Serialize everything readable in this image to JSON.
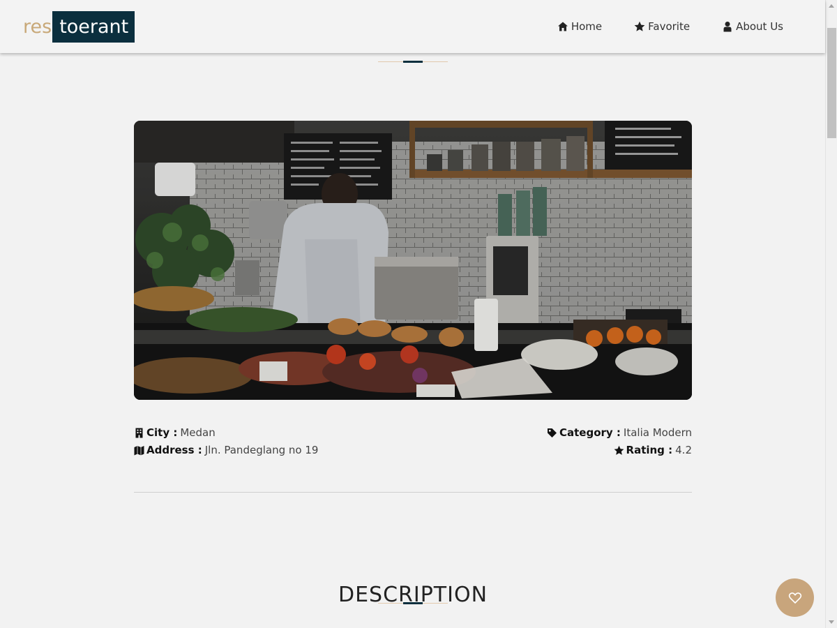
{
  "header": {
    "logo_part1": "res",
    "logo_part2": "toerant",
    "nav": [
      {
        "label": "Home",
        "icon": "home-icon"
      },
      {
        "label": "Favorite",
        "icon": "star-icon"
      },
      {
        "label": "About Us",
        "icon": "user-icon"
      }
    ]
  },
  "restaurant": {
    "image_alt": "Cafe counter with barista",
    "city_label": "City :",
    "city": "Medan",
    "address_label": "Address :",
    "address": "Jln. Pandeglang no 19",
    "category_label": "Category :",
    "category": "Italia Modern",
    "rating_label": "Rating :",
    "rating": "4.2"
  },
  "description": {
    "title": "DESCRIPTION"
  },
  "favorite_button": {
    "icon": "heart-icon"
  },
  "colors": {
    "accent": "#c8a57c",
    "brand_dark": "#0b2f3e",
    "background": "#f2f2f2"
  }
}
